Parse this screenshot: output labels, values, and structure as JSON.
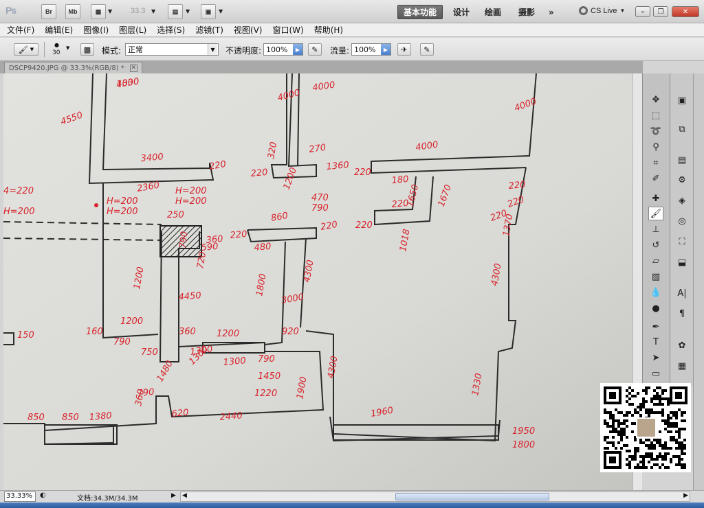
{
  "app": {
    "logo": "Ps",
    "bridge_label": "Br",
    "minibridge_label": "Mb",
    "zoom_level_label": "33.3",
    "workspaces": [
      "基本功能",
      "设计",
      "绘画",
      "摄影"
    ],
    "more_label": "»",
    "cslive_label": "CS Live"
  },
  "menu": [
    "文件(F)",
    "编辑(E)",
    "图像(I)",
    "图层(L)",
    "选择(S)",
    "滤镜(T)",
    "视图(V)",
    "窗口(W)",
    "帮助(H)"
  ],
  "options": {
    "brush_size": "30",
    "mode_label": "模式:",
    "mode_value": "正常",
    "opacity_label": "不透明度:",
    "opacity_value": "100%",
    "flow_label": "流量:",
    "flow_value": "100%"
  },
  "document": {
    "tab_title": "DSCP9420.JPG @ 33.3%(RGB/8) *"
  },
  "drawing_labels": [
    "4000",
    "4550",
    "3400",
    "220",
    "4000",
    "4000",
    "320",
    "270",
    "220",
    "1200",
    "1360",
    "4000",
    "4000",
    "4=220",
    "H=200",
    "H=200",
    "H=200",
    "2360",
    "H=200",
    "H=200",
    "250",
    "790",
    "470",
    "790",
    "1650",
    "1670",
    "220",
    "220",
    "220",
    "220",
    "220",
    "180",
    "220",
    "860",
    "480",
    "220",
    "220",
    "1018",
    "590",
    "720",
    "1200",
    "4300",
    "1800",
    "4300",
    "360",
    "1370",
    "4450",
    "3000",
    "150",
    "1200",
    "160",
    "790",
    "750",
    "1200",
    "360",
    "920",
    "790",
    "790",
    "1450",
    "1220",
    "1300",
    "1900",
    "1480",
    "1300",
    "1300",
    "850",
    "1330",
    "850",
    "1380",
    "360",
    "620",
    "2440",
    "1960",
    "4300",
    "1950",
    "1800",
    "1330"
  ],
  "status": {
    "zoom": "33.33%",
    "doc_info": "文档:34.3M/34.3M"
  },
  "colors": {
    "drawing_red": "#d8242c",
    "drawing_ink": "#2b2b2b",
    "paper": "#dcdcd8",
    "active_workspace": "#5e5e5e"
  },
  "icons": {
    "brush_tool": "brush-icon",
    "move_tool": "move-icon",
    "marquee_tool": "marquee-icon",
    "lasso_tool": "lasso-icon",
    "quick_select_tool": "quick-select-icon",
    "crop_tool": "crop-icon",
    "eyedropper_tool": "eyedropper-icon",
    "healing_tool": "healing-icon",
    "stamp_tool": "stamp-icon",
    "history_brush_tool": "history-brush-icon",
    "eraser_tool": "eraser-icon",
    "gradient_tool": "gradient-icon",
    "blur_tool": "blur-icon",
    "dodge_tool": "dodge-icon",
    "pen_tool": "pen-icon",
    "type_tool": "type-icon",
    "path_select_tool": "path-select-icon",
    "shape_tool": "shape-icon"
  }
}
